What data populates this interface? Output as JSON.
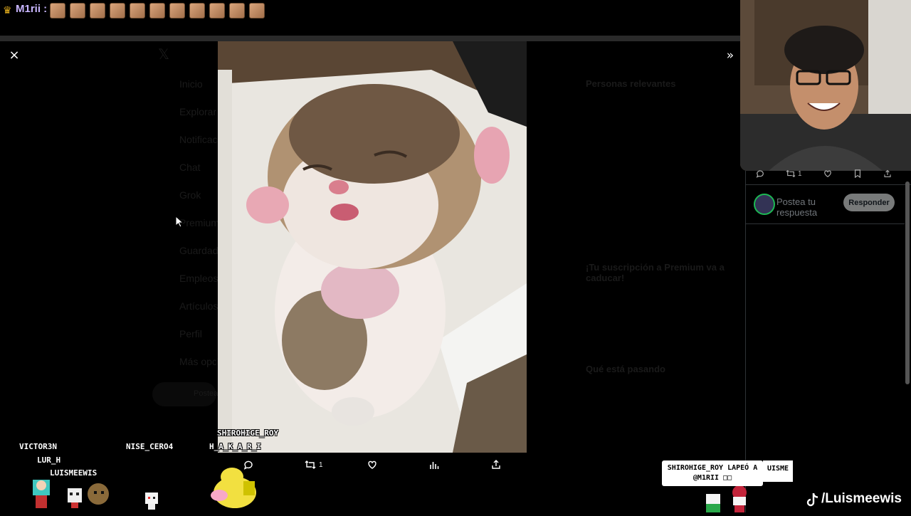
{
  "chat": {
    "crown": "♛",
    "user": "M1rii :",
    "emote_count": 11
  },
  "viewer": {
    "close": "×",
    "expand": "»"
  },
  "sidebar_ghost": [
    "Inicio",
    "Explorar",
    "Notificaciones",
    "Chat",
    "Grok",
    "Premium",
    "Guardados",
    "Empleos",
    "Artículos",
    "Perfil",
    "Más opciones"
  ],
  "post_ghost_label": "Postear",
  "right_ghost": {
    "section1": "Personas relevantes",
    "section2_title": "¡Tu suscripción a Premium va a caducar!",
    "section3_title": "Qué está pasando"
  },
  "actions": {
    "retweets": "1"
  },
  "reply": {
    "placeholder": "Postea tu respuesta",
    "button": "Responder",
    "retweets": "1"
  },
  "overlay": {
    "names": [
      "VICTOR3N",
      "LUR_H",
      "LUISMEEWIS",
      "NISE_CERO4",
      "SHIROHIGE_ROY",
      "H_A_K_A_R_I"
    ],
    "toast": "SHIROHIGE_ROY LAPEÓ A @M1RII □□",
    "toast2": "UISME",
    "tiktok": "/Luismeewis"
  }
}
